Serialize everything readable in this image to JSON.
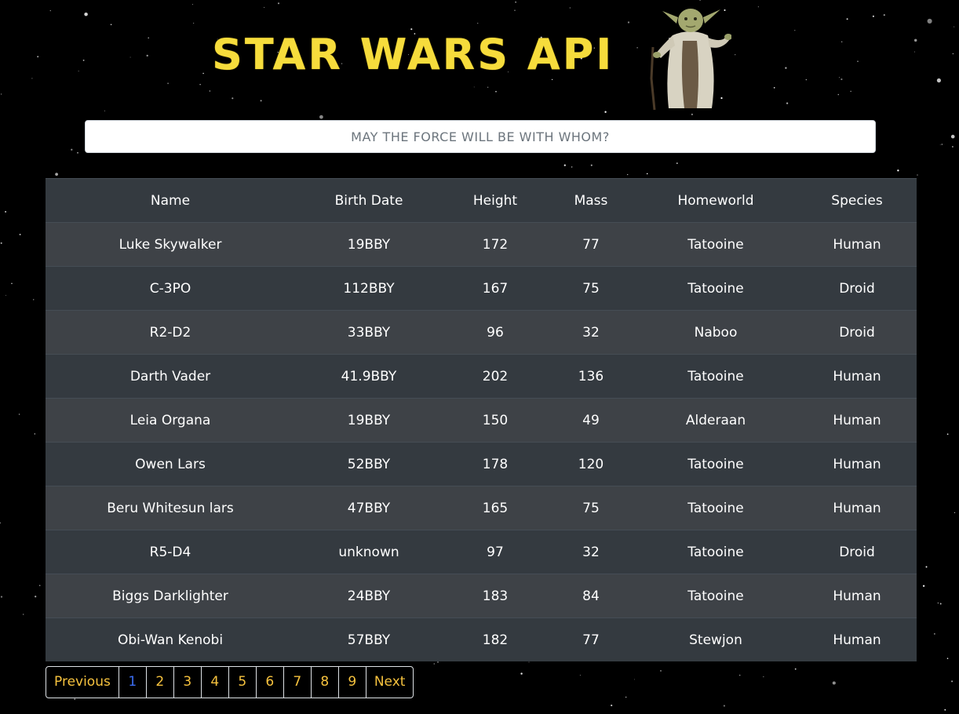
{
  "header": {
    "title": "STAR WARS API"
  },
  "search": {
    "placeholder": "MAY THE FORCE WILL BE WITH WHOM?"
  },
  "table": {
    "columns": [
      "Name",
      "Birth Date",
      "Height",
      "Mass",
      "Homeworld",
      "Species"
    ],
    "rows": [
      [
        "Luke Skywalker",
        "19BBY",
        "172",
        "77",
        "Tatooine",
        "Human"
      ],
      [
        "C-3PO",
        "112BBY",
        "167",
        "75",
        "Tatooine",
        "Droid"
      ],
      [
        "R2-D2",
        "33BBY",
        "96",
        "32",
        "Naboo",
        "Droid"
      ],
      [
        "Darth Vader",
        "41.9BBY",
        "202",
        "136",
        "Tatooine",
        "Human"
      ],
      [
        "Leia Organa",
        "19BBY",
        "150",
        "49",
        "Alderaan",
        "Human"
      ],
      [
        "Owen Lars",
        "52BBY",
        "178",
        "120",
        "Tatooine",
        "Human"
      ],
      [
        "Beru Whitesun lars",
        "47BBY",
        "165",
        "75",
        "Tatooine",
        "Human"
      ],
      [
        "R5-D4",
        "unknown",
        "97",
        "32",
        "Tatooine",
        "Droid"
      ],
      [
        "Biggs Darklighter",
        "24BBY",
        "183",
        "84",
        "Tatooine",
        "Human"
      ],
      [
        "Obi-Wan Kenobi",
        "57BBY",
        "182",
        "77",
        "Stewjon",
        "Human"
      ]
    ]
  },
  "pagination": {
    "previous": "Previous",
    "pages": [
      "1",
      "2",
      "3",
      "4",
      "5",
      "6",
      "7",
      "8",
      "9"
    ],
    "active_page": "1",
    "next": "Next"
  },
  "colors": {
    "title": "#f6dc3c",
    "pagination_text": "#f6c23e",
    "pagination_active": "#3b6df2",
    "row_odd": "#3e4247",
    "row_even": "#343a40"
  },
  "icons": {
    "mascot": "yoda-figure"
  }
}
